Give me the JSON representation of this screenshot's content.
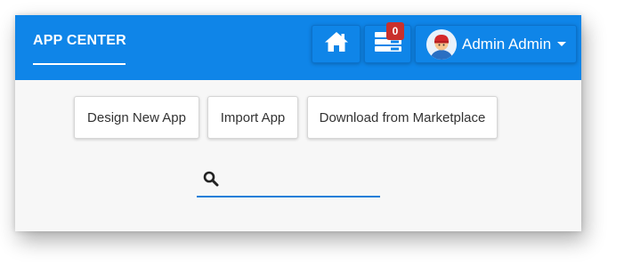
{
  "header": {
    "app_title": "APP CENTER",
    "home_icon": "home-icon",
    "tasks_icon": "tasks-icon",
    "tasks_count": "0",
    "user_name": "Admin Admin",
    "accent_color": "#0f85e8",
    "badge_color": "#c9302c"
  },
  "actions": {
    "design_label": "Design New App",
    "import_label": "Import App",
    "marketplace_label": "Download from Marketplace"
  },
  "search": {
    "value": "",
    "placeholder": ""
  }
}
